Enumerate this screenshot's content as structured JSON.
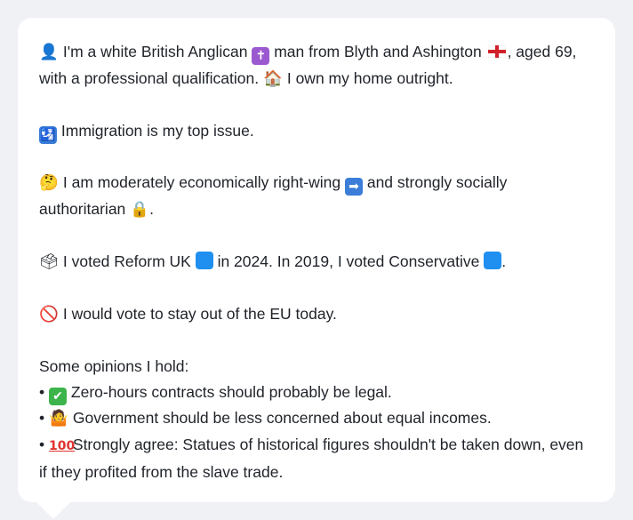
{
  "profile": {
    "line1_intro_icon": "person-silhouette-icon",
    "line1_a": "I'm a white British Anglican",
    "line1_b": "man from Blyth and Ashington",
    "line1_c": ", aged 69, with a professional qualification.",
    "line1_d": "I own my home outright.",
    "line2": "Immigration is my top issue.",
    "line3_a": "I am moderately economically right-wing",
    "line3_b": "and strongly socially authoritarian",
    "line3_c": ".",
    "line4_a": "I voted Reform UK",
    "line4_b": "in 2024. In 2019, I voted Conservative",
    "line4_c": ".",
    "line5": "I would vote to stay out of the EU today.",
    "opinions_heading": "Some opinions I hold:",
    "opinions": [
      {
        "bullet": "•",
        "text": "Zero-hours contracts should probably be legal."
      },
      {
        "bullet": "•",
        "text": "Government should be less concerned about equal incomes."
      },
      {
        "bullet": "•",
        "text": "Strongly agree: Statues of historical figures shouldn't be taken down, even if they profited from the slave trade."
      }
    ]
  },
  "colors": {
    "background": "#eff1f4",
    "card": "#ffffff",
    "text": "#1f2329",
    "reform_blue": "#1f8ff0",
    "conservative_blue": "#1f8ff0",
    "cross_purple": "#9b59d0",
    "check_green": "#3cb44b",
    "no_red": "#e0332f"
  }
}
